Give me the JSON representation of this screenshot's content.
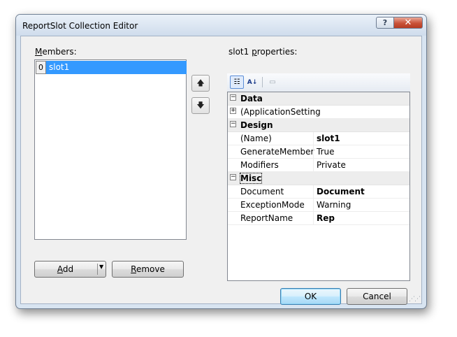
{
  "window": {
    "title": "ReportSlot Collection Editor",
    "help_glyph": "?",
    "close_glyph": "✕"
  },
  "members": {
    "label_pre": "",
    "label_accel": "M",
    "label_post": "embers:",
    "items": [
      {
        "index": "0",
        "name": "slot1"
      }
    ],
    "move_up_glyph": "🡅",
    "move_down_glyph": "🡇"
  },
  "buttons": {
    "add_accel": "A",
    "add_rest": "dd",
    "add_dropdown_glyph": "▼",
    "remove_accel": "R",
    "remove_rest": "emove",
    "ok": "OK",
    "cancel": "Cancel"
  },
  "properties": {
    "label_pre": "slot1 ",
    "label_accel": "p",
    "label_post": "roperties:",
    "toolbar": {
      "categorized_glyph": "☷",
      "alphabetical_glyph": "A↓",
      "property_pages_glyph": "▭"
    },
    "rows": [
      {
        "kind": "category",
        "name": "Data",
        "expander": "−"
      },
      {
        "kind": "item",
        "name": "(ApplicationSetting",
        "value": "",
        "bold": false,
        "expander": "+"
      },
      {
        "kind": "category",
        "name": "Design",
        "expander": "−"
      },
      {
        "kind": "item",
        "name": "(Name)",
        "value": "slot1",
        "bold": true
      },
      {
        "kind": "item",
        "name": "GenerateMember",
        "value": "True",
        "bold": false
      },
      {
        "kind": "item",
        "name": "Modifiers",
        "value": "Private",
        "bold": false
      },
      {
        "kind": "category",
        "name": "Misc",
        "expander": "−"
      },
      {
        "kind": "item",
        "name": "Document",
        "value": "Document",
        "bold": true
      },
      {
        "kind": "item",
        "name": "ExceptionMode",
        "value": "Warning",
        "bold": false
      },
      {
        "kind": "item",
        "name": "ReportName",
        "value": "Rep",
        "bold": true
      }
    ]
  },
  "colors": {
    "selection": "#3399ff",
    "dialog_frame": "#d8e4f1",
    "client_bg": "#f0f0f0"
  }
}
